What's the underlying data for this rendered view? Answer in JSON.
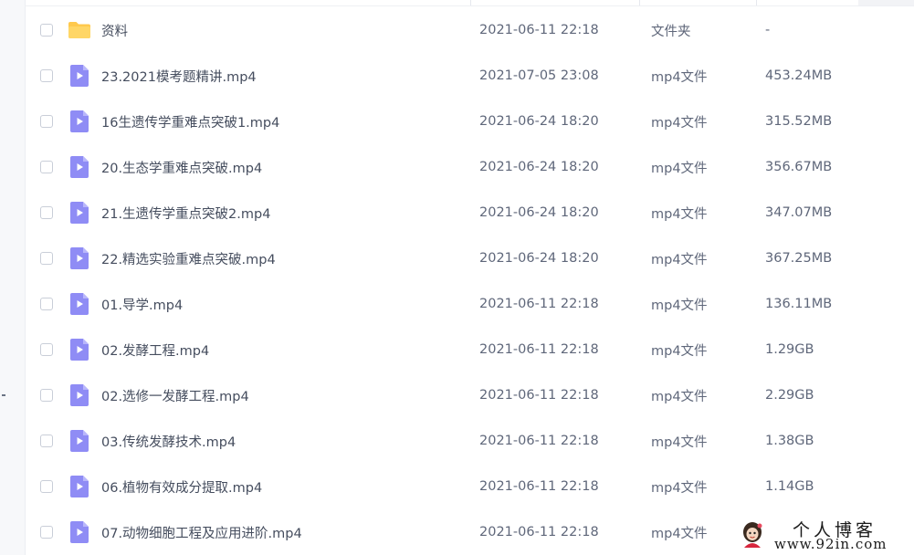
{
  "files": [
    {
      "icon": "folder-icon",
      "name": "资料",
      "date": "2021-06-11 22:18",
      "type": "文件夹",
      "size": "-"
    },
    {
      "icon": "video-file-icon",
      "name": "23.2021模考题精讲.mp4",
      "date": "2021-07-05 23:08",
      "type": "mp4文件",
      "size": "453.24MB"
    },
    {
      "icon": "video-file-icon",
      "name": "16生遗传学重难点突破1.mp4",
      "date": "2021-06-24 18:20",
      "type": "mp4文件",
      "size": "315.52MB"
    },
    {
      "icon": "video-file-icon",
      "name": "20.生态学重难点突破.mp4",
      "date": "2021-06-24 18:20",
      "type": "mp4文件",
      "size": "356.67MB"
    },
    {
      "icon": "video-file-icon",
      "name": "21.生遗传学重点突破2.mp4",
      "date": "2021-06-24 18:20",
      "type": "mp4文件",
      "size": "347.07MB"
    },
    {
      "icon": "video-file-icon",
      "name": "22.精选实验重难点突破.mp4",
      "date": "2021-06-24 18:20",
      "type": "mp4文件",
      "size": "367.25MB"
    },
    {
      "icon": "video-file-icon",
      "name": "01.导学.mp4",
      "date": "2021-06-11 22:18",
      "type": "mp4文件",
      "size": "136.11MB"
    },
    {
      "icon": "video-file-icon",
      "name": "02.发酵工程.mp4",
      "date": "2021-06-11 22:18",
      "type": "mp4文件",
      "size": "1.29GB"
    },
    {
      "icon": "video-file-icon",
      "name": "02.选修一发酵工程.mp4",
      "date": "2021-06-11 22:18",
      "type": "mp4文件",
      "size": "2.29GB"
    },
    {
      "icon": "video-file-icon",
      "name": "03.传统发酵技术.mp4",
      "date": "2021-06-11 22:18",
      "type": "mp4文件",
      "size": "1.38GB"
    },
    {
      "icon": "video-file-icon",
      "name": "06.植物有效成分提取.mp4",
      "date": "2021-06-11 22:18",
      "type": "mp4文件",
      "size": "1.14GB"
    },
    {
      "icon": "video-file-icon",
      "name": "07.动物细胞工程及应用进阶.mp4",
      "date": "2021-06-11 22:18",
      "type": "mp4文件",
      "size": ""
    }
  ],
  "watermark": {
    "title": "个人博客",
    "url": "www.92in.com"
  },
  "colors": {
    "folder": "#ffc94d",
    "video": "#8f8cf5",
    "checkbox_border": "#c9ced8"
  }
}
